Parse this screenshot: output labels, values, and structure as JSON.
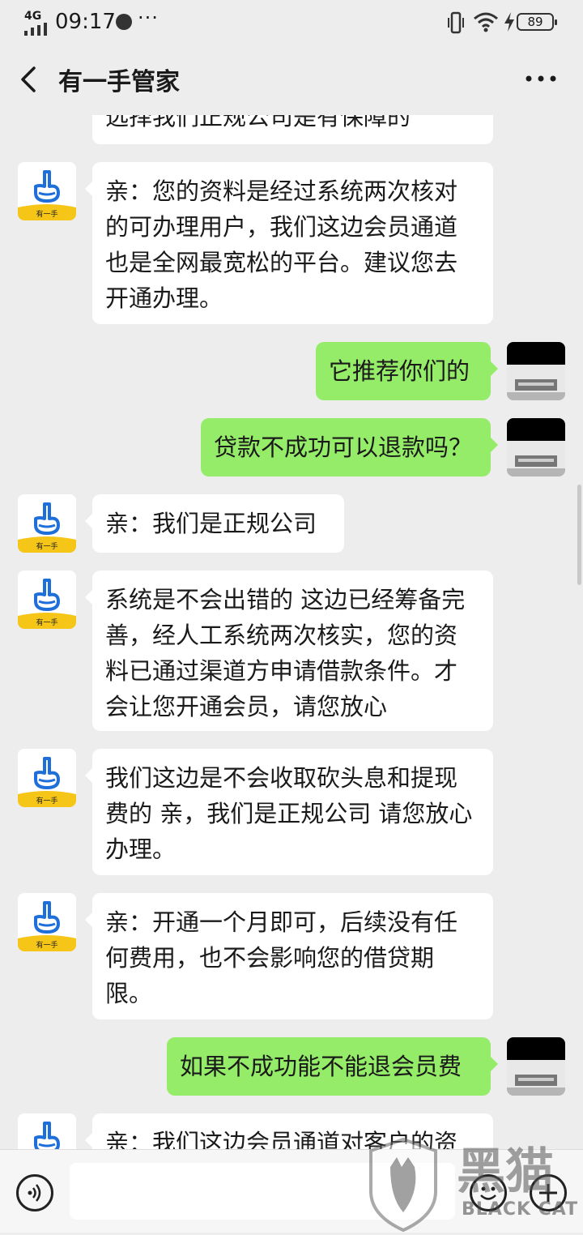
{
  "status_bar": {
    "network": "4G",
    "time": "09:17",
    "dots": "···",
    "battery": "89"
  },
  "header": {
    "title": "有一手管家"
  },
  "bot_avatar_label": "有一手",
  "messages": [
    {
      "side": "left",
      "text": "选择我们正规公司是有保障的"
    },
    {
      "side": "left",
      "text": "亲：您的资料是经过系统两次核对的可办理用户，我们这边会员通道也是全网最宽松的平台。建议您去开通办理。"
    },
    {
      "side": "right",
      "text": "它推荐你们的"
    },
    {
      "side": "right",
      "text": "贷款不成功可以退款吗？"
    },
    {
      "side": "left",
      "text": "亲：我们是正规公司"
    },
    {
      "side": "left",
      "text": "系统是不会出错的 这边已经筹备完善，经人工系统两次核实，您的资料已通过渠道方申请借款条件。才会让您开通会员，请您放心"
    },
    {
      "side": "left",
      "text": "我们这边是不会收取砍头息和提现费的 亲，我们是正规公司 请您放心办理。"
    },
    {
      "side": "left",
      "text": "亲：开通一个月即可，后续没有任何费用，也不会影响您的借贷期限。"
    },
    {
      "side": "right",
      "text": "如果不成功能不能退会员费"
    },
    {
      "side": "left",
      "text": "亲：我们这边会员通道对客户的资"
    }
  ],
  "input": {
    "value": ""
  },
  "watermark": {
    "big": "黑猫",
    "small": "BLACK CAT"
  },
  "colors": {
    "background": "#ededed",
    "bubble_sent": "#95ec69",
    "bubble_received": "#ffffff",
    "bot_avatar_blue": "#1e6fd9",
    "bot_avatar_yellow": "#f5c518"
  },
  "icons": {
    "back": "chevron-left-icon",
    "more": "more-dots-icon",
    "voice": "voice-icon",
    "emoji": "emoji-icon",
    "plus": "plus-icon"
  }
}
